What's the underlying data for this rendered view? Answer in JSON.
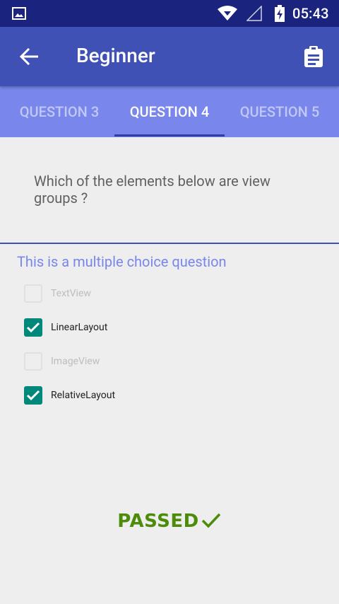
{
  "status_bar": {
    "time": "05:43"
  },
  "app_bar": {
    "title": "Beginner"
  },
  "tabs": [
    {
      "label": "QUESTION 3",
      "active": false
    },
    {
      "label": "QUESTION 4",
      "active": true
    },
    {
      "label": "QUESTION 5",
      "active": false
    }
  ],
  "question": {
    "text": "Which of the elements below are view groups ?"
  },
  "hint": "This is a multiple choice question",
  "options": [
    {
      "label": "TextView",
      "checked": false
    },
    {
      "label": "LinearLayout",
      "checked": true
    },
    {
      "label": "ImageView",
      "checked": false
    },
    {
      "label": "RelativeLayout",
      "checked": true
    }
  ],
  "result": {
    "text": "PASSED"
  },
  "colors": {
    "primary": "#3f51b5",
    "primary_dark": "#1a237e",
    "tab_bar": "#7986eb",
    "checkbox": "#00897b",
    "passed": "#4c8c0a"
  }
}
